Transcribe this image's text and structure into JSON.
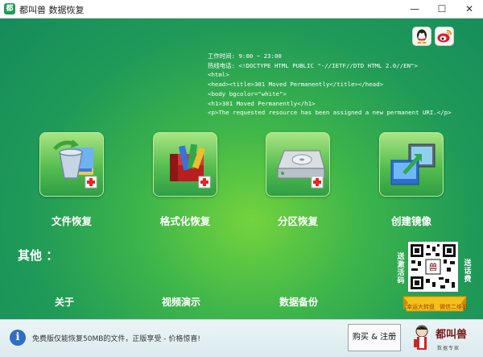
{
  "window": {
    "title": "都叫兽 数据恢复",
    "controls": {
      "minimize": "—",
      "maximize": "☐",
      "close": "✕"
    }
  },
  "social": {
    "qq_icon": "qq-icon",
    "weibo_icon": "weibo-icon"
  },
  "info_lines": [
    "工作时间: 9:00 ~ 23:00",
    "热线电话: <!DOCTYPE HTML PUBLIC \"-//IETF//DTD HTML 2.0//EN\">",
    "<html>",
    "<head><title>301 Moved Permanently</title></head>",
    "<body bgcolor=\"white\">",
    "<h1>301 Moved Permanently</h1>",
    "<p>The requested resource has been assigned a new permanent URI.</p>"
  ],
  "features": [
    {
      "label": "文件恢复",
      "icon": "file-recovery-icon"
    },
    {
      "label": "格式化恢复",
      "icon": "format-recovery-icon"
    },
    {
      "label": "分区恢复",
      "icon": "partition-recovery-icon"
    },
    {
      "label": "创建镜像",
      "icon": "create-image-icon"
    }
  ],
  "other": {
    "heading": "其他 ：",
    "links": [
      "关于",
      "视频演示",
      "数据备份"
    ]
  },
  "qr": {
    "left_text": "送激活码",
    "right_text": "送话费",
    "banner_left": "幸运大转盘",
    "banner_right": "微信二维码"
  },
  "footer": {
    "notice": "免费版仅能恢复50MB的文件，正版享受 - 价格惊喜!",
    "buy_button": "购买 & 注册",
    "brand_name": "都叫兽",
    "brand_sub": "数据专家"
  },
  "colors": {
    "accent": "#2fa05a",
    "tile": "#55bd4f",
    "info": "#2f6ec4"
  }
}
